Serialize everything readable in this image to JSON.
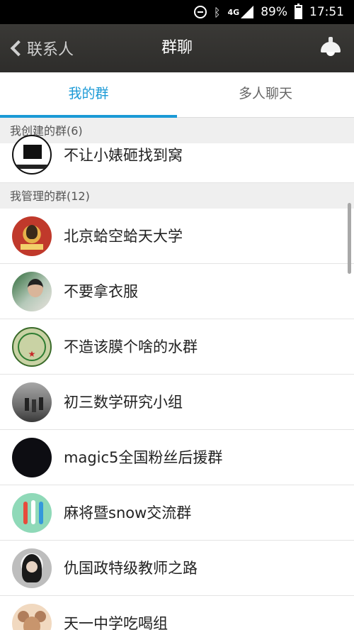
{
  "status_bar": {
    "network": "4G",
    "battery": "89%",
    "battery_level": 0.89,
    "time": "17:51",
    "icons": [
      "do-not-disturb-icon",
      "bluetooth-icon",
      "signal-icon",
      "battery-icon"
    ]
  },
  "header": {
    "back_label": "联系人",
    "title": "群聊",
    "right_icon": "lamp-icon"
  },
  "tabs": [
    {
      "label": "我的群",
      "active": true
    },
    {
      "label": "多人聊天",
      "active": false
    }
  ],
  "colors": {
    "accent": "#1b9ad6",
    "title_bar": "#33322f",
    "section_bg": "#efefef"
  },
  "sections": {
    "created": {
      "label": "我创建的群(6)",
      "items": [
        {
          "name": "不让小婊砸找到窝"
        }
      ]
    },
    "managed": {
      "label": "我管理的群(12)",
      "items": [
        {
          "name": "北京蛤空蛤天大学"
        },
        {
          "name": "不要拿衣服"
        },
        {
          "name": "不造该膜个啥的水群"
        },
        {
          "name": "初三数学研究小组"
        },
        {
          "name": "magic5全国粉丝后援群"
        },
        {
          "name": "麻将暨snow交流群"
        },
        {
          "name": "仇国政特级教师之路"
        },
        {
          "name": "天一中学吃喝组"
        }
      ]
    }
  }
}
